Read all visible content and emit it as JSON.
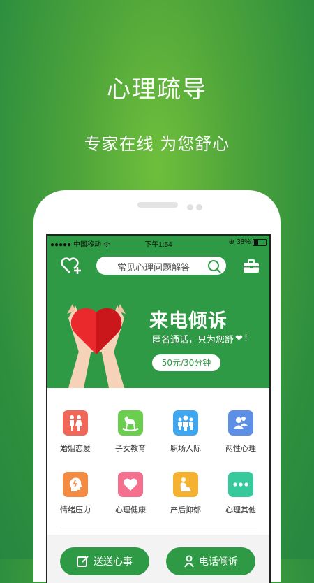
{
  "hero": {
    "title": "心理疏导",
    "subtitle": "专家在线  为您舒心"
  },
  "status": {
    "carrier": "●●●●● 中国移动",
    "time": "下午1:54",
    "battery": "38%"
  },
  "search": {
    "placeholder": "常见心理问题解答"
  },
  "banner": {
    "title": "来电倾诉",
    "subtitle": "匿名通话，只为您舒",
    "subtitle_end": "!",
    "price": "50元/30分钟"
  },
  "categories": [
    {
      "label": "婚姻恋爱",
      "color": "#f0675a",
      "icon": "couple-icon"
    },
    {
      "label": "子女教育",
      "color": "#6cce4f",
      "icon": "rocking-horse-icon"
    },
    {
      "label": "职场人际",
      "color": "#3fa6f0",
      "icon": "group-icon"
    },
    {
      "label": "两性心理",
      "color": "#5e8fe6",
      "icon": "two-people-icon"
    },
    {
      "label": "情绪压力",
      "color": "#f38b43",
      "icon": "head-stress-icon"
    },
    {
      "label": "心理健康",
      "color": "#f56f8f",
      "icon": "heart-icon"
    },
    {
      "label": "产后抑郁",
      "color": "#f5b231",
      "icon": "mother-icon"
    },
    {
      "label": "心理其他",
      "color": "#35c99c",
      "icon": "more-icon"
    }
  ],
  "buttons": {
    "left": "送送心事",
    "right": "电话倾诉"
  },
  "colors": {
    "brand": "#2f9a45",
    "background_top": "#6fbf3c",
    "background_edge": "#278640"
  }
}
